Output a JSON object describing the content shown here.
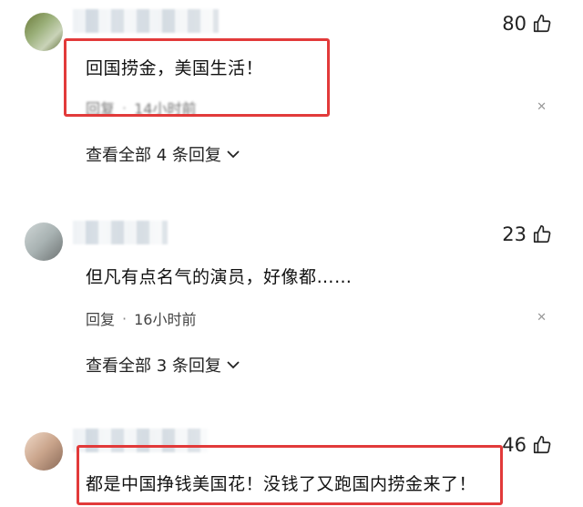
{
  "comments": [
    {
      "text": "回国捞金，美国生活！",
      "likes": "80",
      "reply_label": "回复",
      "time": "14小时前",
      "view_replies": "查看全部 4 条回复"
    },
    {
      "text": "但凡有点名气的演员，好像都……",
      "likes": "23",
      "reply_label": "回复",
      "time": "16小时前",
      "view_replies": "查看全部 3 条回复"
    },
    {
      "text": "都是中国挣钱美国花！没钱了又跑国内捞金来了！",
      "likes": "46"
    }
  ],
  "icons": {
    "like": "thumbs-up-icon",
    "close": "close-icon",
    "expand": "chevron-down-icon"
  },
  "colors": {
    "highlight_border": "#e23a3a"
  }
}
